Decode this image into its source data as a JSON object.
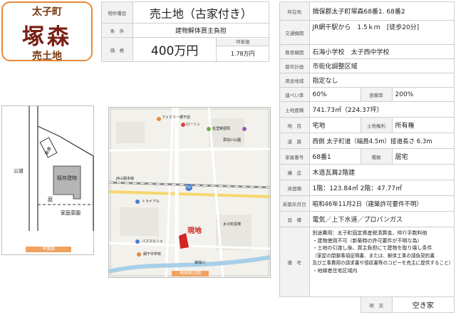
{
  "title_card": {
    "town": "太子町",
    "area": "塚森",
    "kind": "売土地"
  },
  "summary": [
    {
      "label": "物件種目",
      "value": "売土地（古家付き）"
    },
    {
      "label": "条　件",
      "value": "建物解体買主負担"
    },
    {
      "label": "価　格",
      "value": "400万円",
      "sub_label": "坪単価",
      "sub_value": "1.78万円"
    }
  ],
  "details": {
    "address": {
      "label": "所在地",
      "value": "揖保郡太子町塚森68番1. 68番2"
    },
    "transport": {
      "label": "交通機関",
      "line1": "JR網干駅から　1.5ｋｍ　[徒歩20分]"
    },
    "school": {
      "label": "教育機関",
      "value": "石海小学校　太子西中学校"
    },
    "planning": {
      "label": "都市計画",
      "value": "市街化調整区域"
    },
    "zoning": {
      "label": "用途地域",
      "value": "指定なし"
    },
    "coverage": {
      "label": "建ぺい率",
      "value": "60%",
      "label2": "容積率",
      "value2": "200%"
    },
    "land_area": {
      "label": "土地面積",
      "value": "741.73㎡（224.37坪）"
    },
    "land_category": {
      "label": "地　目",
      "value": "宅地",
      "label2": "土地権利",
      "value2": "所有権"
    },
    "road": {
      "label": "道　路",
      "value": "西側  太子町道（幅員4.5m）接道長さ 6.3m"
    },
    "house_no": {
      "label": "家屋番号",
      "value": "68番1",
      "label2": "種類",
      "value2": "居宅"
    },
    "structure": {
      "label": "構　造",
      "value": "木造瓦葺2階建"
    },
    "floor_area": {
      "label": "床面積",
      "value": "1階：123.84㎡  2階：47.77㎡"
    },
    "built": {
      "label": "新築年月日",
      "value": "昭和46年11月2日（建築許可要件不明）"
    },
    "facilities": {
      "label": "設　備",
      "value": "電気／上下水道／プロパンガス"
    },
    "remarks": {
      "label": "備　考",
      "lines": [
        "別途費用：太子町固定資産税清算金、仲介手数料他",
        "・建物使用不可（新築時の許可要件が不明な為）",
        "・土地の引渡し後、買主負担にて建物を取り壊し条件",
        "（家屋の閉鎖事項証明書、または、解体工事の請負契約書",
        "及び工事費用の請求書や領収書等のコピーを売主に提供すること）",
        "・地縁者住宅区域内"
      ]
    },
    "status": {
      "label": "現　況",
      "value": "空き家"
    }
  },
  "layout_plan": {
    "labels": {
      "road": "公道",
      "garage": "車庫",
      "building": "既存建物",
      "yard": "庭",
      "garden": "家庭菜園"
    },
    "caption": "平面図"
  },
  "map": {
    "marker": "現地",
    "caption": "現地周辺図",
    "labels": [
      "ファミリー網干店",
      "ローソン",
      "佐里郵便局",
      "夢前川公園",
      "JR山陽本線",
      "揖保川",
      "トライアル",
      "バスマルシェ",
      "網干中学校",
      "太子町役場"
    ],
    "route_numbers": [
      "250"
    ]
  }
}
